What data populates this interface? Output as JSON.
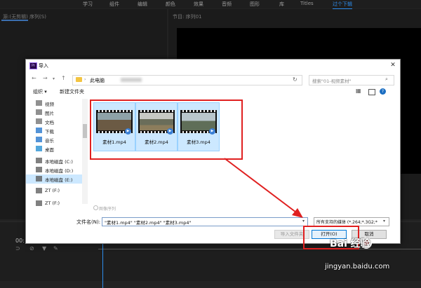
{
  "app": {
    "menubar": [
      "学习",
      "组件",
      "编辑",
      "颜色",
      "效果",
      "音频",
      "图形",
      "库",
      "Titles",
      "过个下辑"
    ],
    "left_panel_title": "源:(无剪辑) 序列(S)",
    "right_panel_title": "节目: 序列01",
    "timecode": "00:"
  },
  "dialog": {
    "title": "导入",
    "address": {
      "crumb": "此电脑",
      "search_placeholder": "搜索\"01-视频素材\""
    },
    "toolbar": {
      "organize": "组织 ▾",
      "new_folder": "新建文件夹"
    },
    "nav_items": [
      {
        "label": "视频",
        "icon": "video-icon",
        "color": "#6b6b6b"
      },
      {
        "label": "图片",
        "icon": "picture-icon",
        "color": "#6b6b6b"
      },
      {
        "label": "文档",
        "icon": "document-icon",
        "color": "#6b6b6b"
      },
      {
        "label": "下载",
        "icon": "download-icon",
        "color": "#1a6fc9"
      },
      {
        "label": "音乐",
        "icon": "music-icon",
        "color": "#1a6fc9"
      },
      {
        "label": "桌面",
        "icon": "desktop-icon",
        "color": "#1a8ad0"
      },
      {
        "label": "本地磁盘 (C:)",
        "icon": "drive-icon",
        "color": "#555"
      },
      {
        "label": "本地磁盘 (D:)",
        "icon": "drive-icon",
        "color": "#555"
      },
      {
        "label": "本地磁盘 (E:)",
        "icon": "drive-icon",
        "color": "#555"
      },
      {
        "label": "ZT (F:)",
        "icon": "drive-icon",
        "color": "#555"
      },
      {
        "label": "ZT (F:)",
        "icon": "drive-icon",
        "color": "#555"
      }
    ],
    "files": [
      {
        "name": "素材1.mp4"
      },
      {
        "name": "素材2.mp4"
      },
      {
        "name": "素材3.mp4"
      }
    ],
    "image_sequence_label": "图像序列",
    "filename_label": "文件名(N):",
    "filename_value": "\"素材1.mp4\" \"素材2.mp4\" \"素材3.mp4\"",
    "filetype_value": "所有支持的媒体 (*.264;*.3G2;*",
    "import_folder_label": "导入文件夹",
    "open_label": "打开(O)",
    "cancel_label": "取消"
  },
  "watermark": {
    "brand": "Bai 经验",
    "url": "jingyan.baidu.com"
  },
  "colors": {
    "highlight": "#e02020",
    "selection": "#cce8ff",
    "accent": "#0078d7"
  }
}
